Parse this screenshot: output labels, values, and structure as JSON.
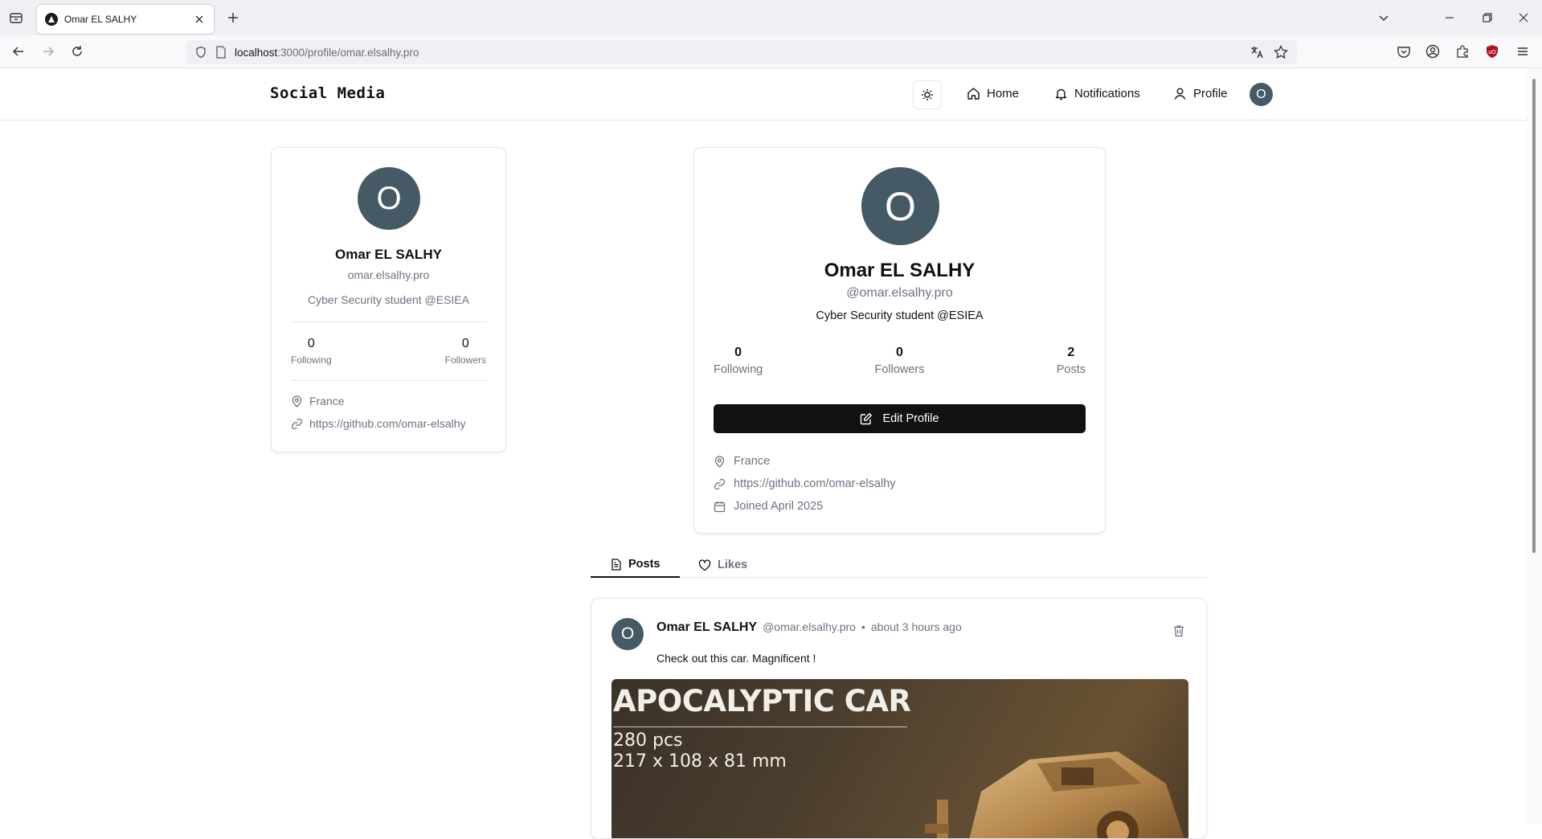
{
  "browser": {
    "tab_title": "Omar EL SALHY",
    "url_host": "localhost",
    "url_rest": ":3000/profile/omar.elsalhy.pro"
  },
  "header": {
    "brand": "Social Media",
    "nav": {
      "home": "Home",
      "notifications": "Notifications",
      "profile": "Profile"
    },
    "avatar_initial": "O"
  },
  "sidebar_card": {
    "avatar_initial": "O",
    "name": "Omar EL SALHY",
    "handle": "omar.elsalhy.pro",
    "bio": "Cyber Security student @ESIEA",
    "following_count": "0",
    "following_label": "Following",
    "followers_count": "0",
    "followers_label": "Followers",
    "location": "France",
    "website": "https://github.com/omar-elsalhy"
  },
  "profile": {
    "avatar_initial": "O",
    "name": "Omar EL SALHY",
    "handle": "@omar.elsalhy.pro",
    "bio": "Cyber Security student @ESIEA",
    "stats": {
      "following_count": "0",
      "following_label": "Following",
      "followers_count": "0",
      "followers_label": "Followers",
      "posts_count": "2",
      "posts_label": "Posts"
    },
    "edit_button": "Edit Profile",
    "location": "France",
    "website": "https://github.com/omar-elsalhy",
    "joined": "Joined April 2025"
  },
  "tabs": {
    "posts": "Posts",
    "likes": "Likes"
  },
  "post": {
    "avatar_initial": "O",
    "author": "Omar EL SALHY",
    "handle": "@omar.elsalhy.pro",
    "separator": "•",
    "time": "about 3 hours ago",
    "text": "Check out this car. Magnificent !",
    "image_title": "APOCALYPTIC CAR",
    "image_line1": "280 pcs",
    "image_line2": "217 x 108 x 81 mm"
  },
  "colors": {
    "avatar_bg": "#455a64",
    "button_bg": "#111111",
    "muted_text": "#6b7280",
    "border": "#e5e7eb"
  }
}
